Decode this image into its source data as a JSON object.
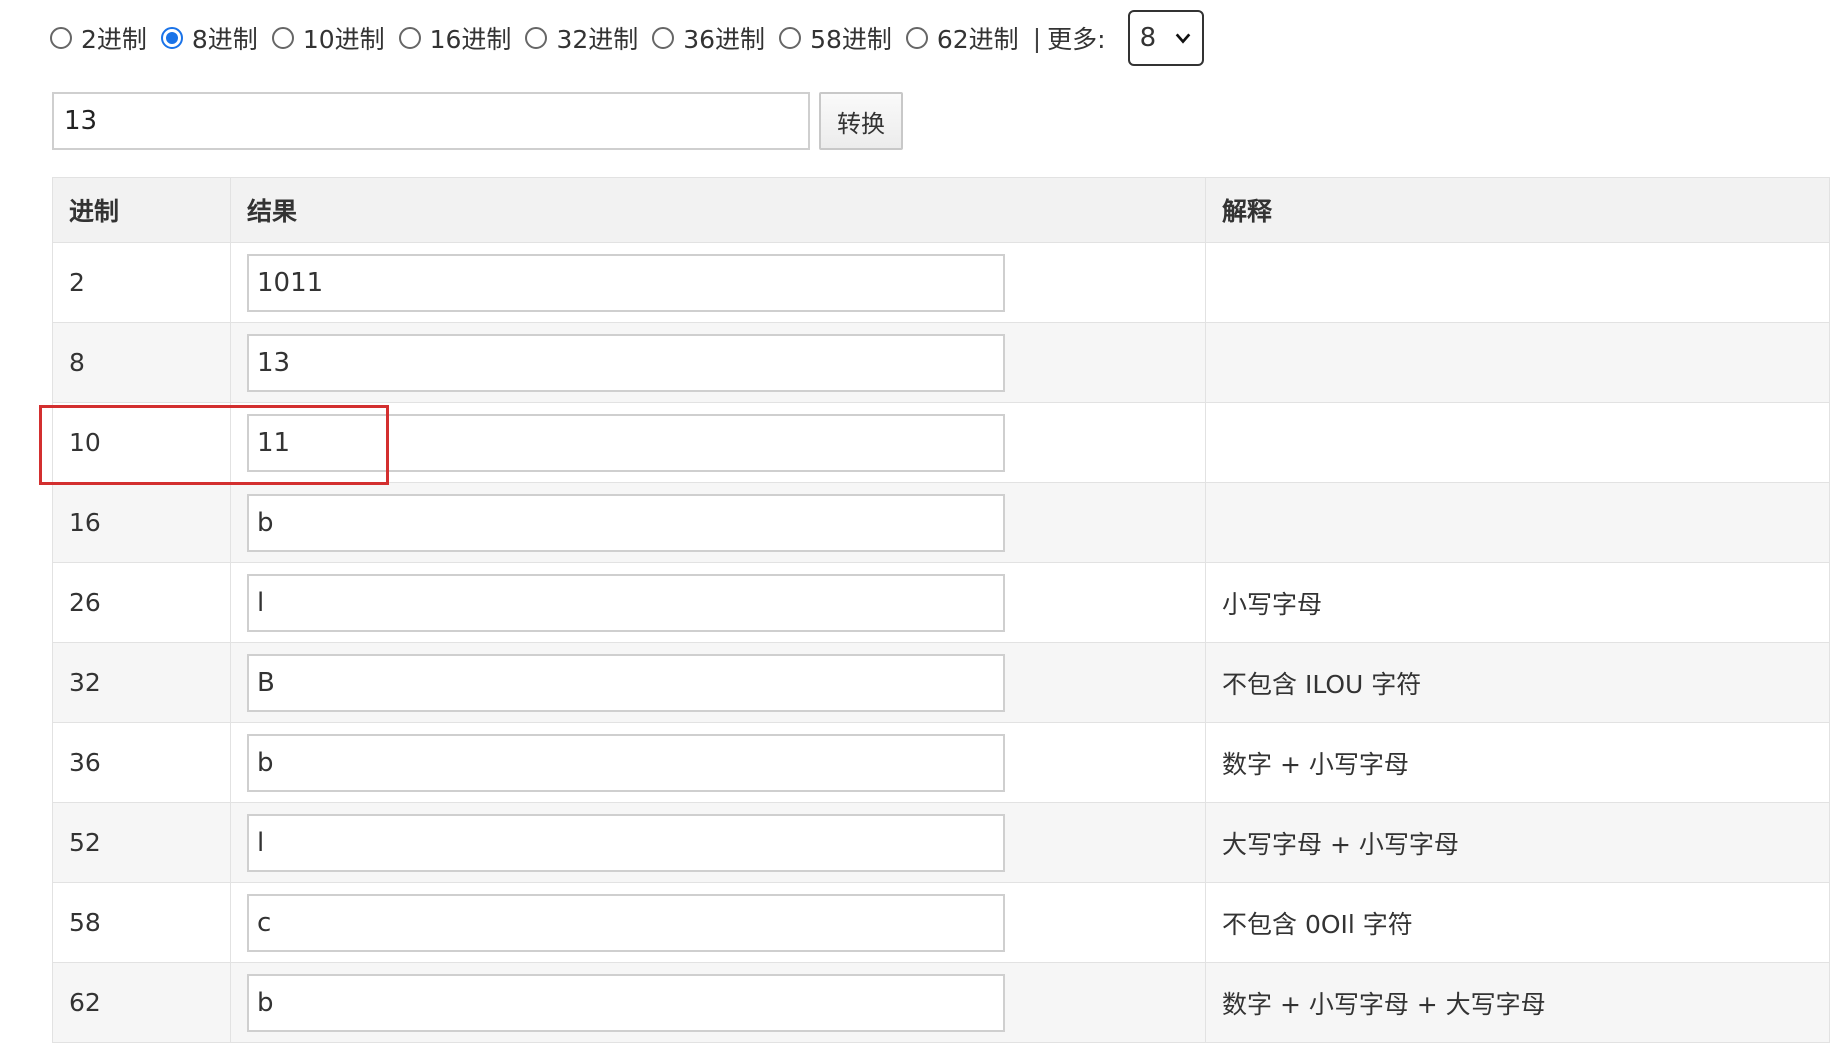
{
  "radix_options": [
    {
      "label": "2进制",
      "checked": false
    },
    {
      "label": "8进制",
      "checked": true
    },
    {
      "label": "10进制",
      "checked": false
    },
    {
      "label": "16进制",
      "checked": false
    },
    {
      "label": "32进制",
      "checked": false
    },
    {
      "label": "36进制",
      "checked": false
    },
    {
      "label": "58进制",
      "checked": false
    },
    {
      "label": "62进制",
      "checked": false
    }
  ],
  "separator": "|",
  "more_label": "更多:",
  "more_select_value": "8",
  "input_value": "13",
  "convert_button": "转换",
  "table": {
    "headers": [
      "进制",
      "结果",
      "解释"
    ],
    "rows": [
      {
        "base": "2",
        "result": "1011",
        "note": ""
      },
      {
        "base": "8",
        "result": "13",
        "note": ""
      },
      {
        "base": "10",
        "result": "11",
        "note": ""
      },
      {
        "base": "16",
        "result": "b",
        "note": ""
      },
      {
        "base": "26",
        "result": "l",
        "note": "小写字母"
      },
      {
        "base": "32",
        "result": "B",
        "note": "不包含 ILOU 字符"
      },
      {
        "base": "36",
        "result": "b",
        "note": "数字 + 小写字母"
      },
      {
        "base": "52",
        "result": "l",
        "note": "大写字母 + 小写字母"
      },
      {
        "base": "58",
        "result": "c",
        "note": "不包含 0OIl 字符"
      },
      {
        "base": "62",
        "result": "b",
        "note": "数字 + 小写字母 + 大写字母"
      }
    ]
  },
  "colors": {
    "radio_checked": "#1a73e8",
    "highlight": "#d32f2f"
  }
}
